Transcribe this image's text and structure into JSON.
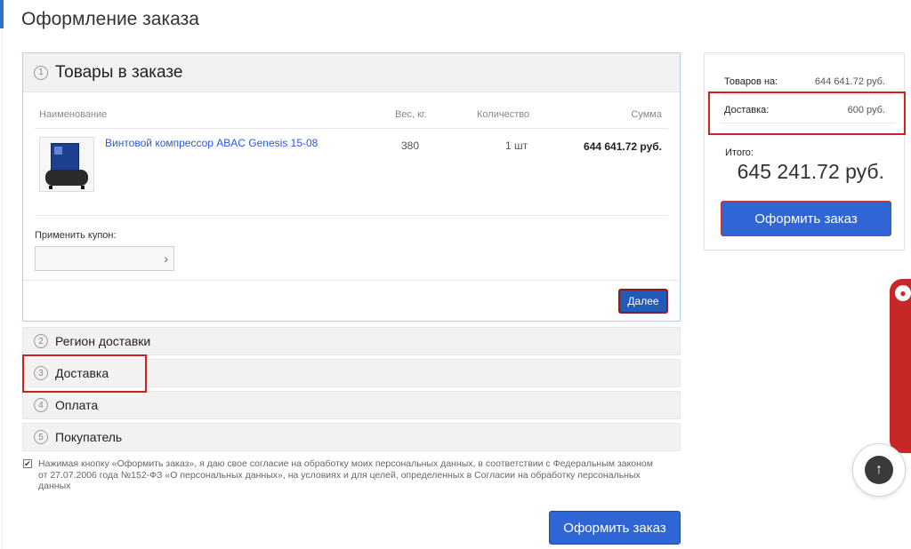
{
  "page": {
    "title": "Оформление заказа"
  },
  "steps": [
    {
      "num": "1",
      "title": "Товары в заказе"
    },
    {
      "num": "2",
      "title": "Регион доставки"
    },
    {
      "num": "3",
      "title": "Доставка"
    },
    {
      "num": "4",
      "title": "Оплата"
    },
    {
      "num": "5",
      "title": "Покупатель"
    }
  ],
  "cart": {
    "columns": {
      "name": "Наименование",
      "weight": "Вес, кг.",
      "qty": "Количество",
      "sum": "Сумма"
    },
    "items": [
      {
        "name": "Винтовой компрессор ABAC Genesis 15-08",
        "weight": "380",
        "qty": "1 шт",
        "sum": "644 641.72 руб."
      }
    ],
    "coupon_label": "Применить купон:",
    "coupon_value": "",
    "coupon_placeholder": "",
    "next_label": "Далее"
  },
  "consent": {
    "checked": true,
    "text": "Нажимая кнопку «Оформить заказ», я даю свое согласие на обработку моих персональных данных, в соответствии с Федеральным законом от 27.07.2006 года №152-ФЗ «О персональных данных», на условиях и для целей, определенных в Согласии на обработку персональных данных"
  },
  "submit_label": "Оформить заказ",
  "summary": {
    "goods_label": "Товаров на:",
    "goods_value": "644 641.72 руб.",
    "delivery_label": "Доставка:",
    "delivery_value": "600 руб.",
    "total_label": "Итого:",
    "total_value": "645 241.72 руб.",
    "submit_label": "Оформить заказ"
  },
  "colors": {
    "accent": "#2f65d4",
    "highlight": "#d21f1f",
    "side_tab": "#c62828"
  },
  "icons": {
    "chat": "chat-icon",
    "scroll_top": "arrow-up-icon",
    "coupon_arrow": "chevron-right-icon",
    "checkbox": "checkmark-icon"
  }
}
